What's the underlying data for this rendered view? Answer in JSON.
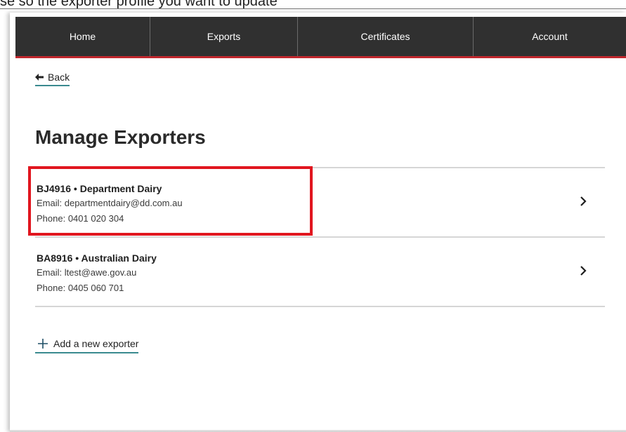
{
  "top_text": "se so the exporter profile you want to update",
  "nav": {
    "items": [
      {
        "label": "Home"
      },
      {
        "label": "Exports"
      },
      {
        "label": "Certificates"
      },
      {
        "label": "Account"
      }
    ],
    "background": "#303030",
    "accent": "#c0272d"
  },
  "back": {
    "label": "Back",
    "icon": "arrow-left-icon"
  },
  "page_title": "Manage Exporters",
  "exporters": [
    {
      "title": "BJ4916 • Department Dairy",
      "email": "Email: departmentdairy@dd.com.au",
      "phone": "Phone: 0401 020 304",
      "highlighted": true
    },
    {
      "title": "BA8916 • Australian Dairy",
      "email": "Email: ltest@awe.gov.au",
      "phone": "Phone: 0405 060 701",
      "highlighted": false
    }
  ],
  "add_exporter": {
    "label": "Add a new exporter",
    "icon": "plus-icon"
  },
  "colors": {
    "link_underline": "#3a8a8f",
    "highlight_border": "#e1161f"
  }
}
